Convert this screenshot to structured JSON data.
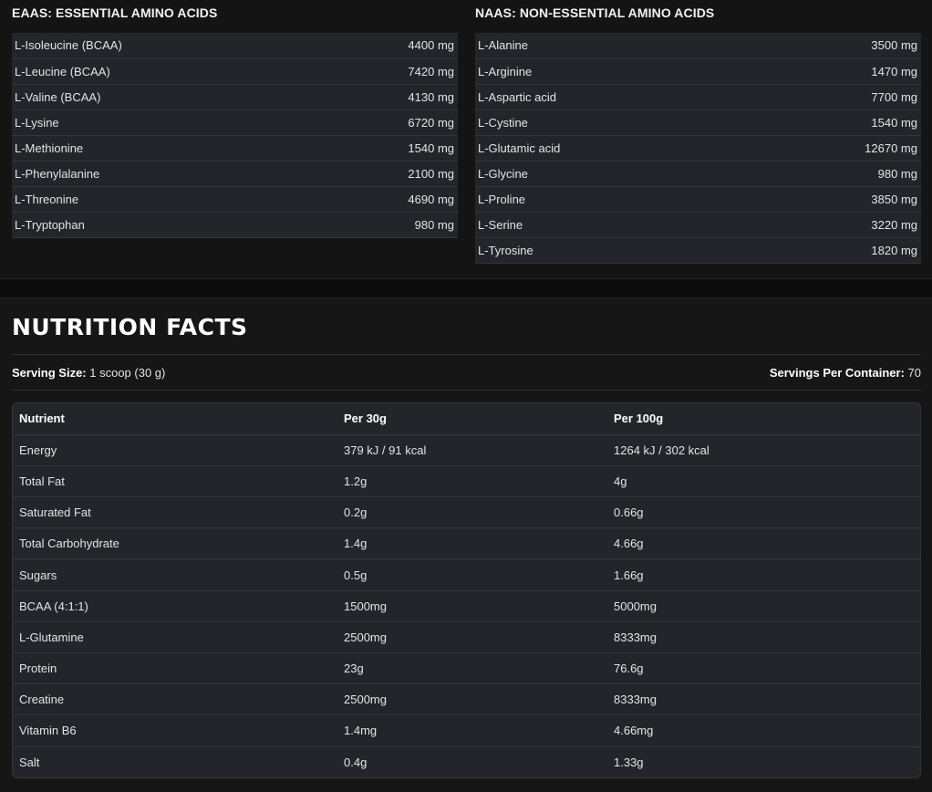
{
  "eaas": {
    "heading": "EAAS: ESSENTIAL AMINO ACIDS",
    "rows": [
      {
        "name": "L-Isoleucine (BCAA)",
        "value": "4400 mg"
      },
      {
        "name": "L-Leucine (BCAA)",
        "value": "7420 mg"
      },
      {
        "name": "L-Valine (BCAA)",
        "value": "4130 mg"
      },
      {
        "name": "L-Lysine",
        "value": "6720 mg"
      },
      {
        "name": "L-Methionine",
        "value": "1540 mg"
      },
      {
        "name": "L-Phenylalanine",
        "value": "2100 mg"
      },
      {
        "name": "L-Threonine",
        "value": "4690 mg"
      },
      {
        "name": "L-Tryptophan",
        "value": "980 mg"
      }
    ]
  },
  "naas": {
    "heading": "NAAS: NON-ESSENTIAL AMINO ACIDS",
    "rows": [
      {
        "name": "L-Alanine",
        "value": "3500 mg"
      },
      {
        "name": "L-Arginine",
        "value": "1470 mg"
      },
      {
        "name": "L-Aspartic acid",
        "value": "7700 mg"
      },
      {
        "name": "L-Cystine",
        "value": "1540 mg"
      },
      {
        "name": "L-Glutamic acid",
        "value": "12670 mg"
      },
      {
        "name": "L-Glycine",
        "value": "980 mg"
      },
      {
        "name": "L-Proline",
        "value": "3850 mg"
      },
      {
        "name": "L-Serine",
        "value": "3220 mg"
      },
      {
        "name": "L-Tyrosine",
        "value": "1820 mg"
      }
    ]
  },
  "nutrition": {
    "title": "NUTRITION FACTS",
    "serving_size_label": "Serving Size:",
    "serving_size_value": " 1 scoop (30 g)",
    "servings_per_container_label": "Servings Per Container:",
    "servings_per_container_value": " 70",
    "columns": [
      "Nutrient",
      "Per 30g",
      "Per 100g"
    ],
    "rows": [
      [
        "Energy",
        "379 kJ / 91 kcal",
        "1264 kJ / 302 kcal"
      ],
      [
        "Total Fat",
        "1.2g",
        "4g"
      ],
      [
        "Saturated Fat",
        "0.2g",
        "0.66g"
      ],
      [
        "Total Carbohydrate",
        "1.4g",
        "4.66g"
      ],
      [
        "Sugars",
        "0.5g",
        "1.66g"
      ],
      [
        "BCAA (4:1:1)",
        "1500mg",
        "5000mg"
      ],
      [
        "L-Glutamine",
        "2500mg",
        "8333mg"
      ],
      [
        "Protein",
        "23g",
        "76.6g"
      ],
      [
        "Creatine",
        "2500mg",
        "8333mg"
      ],
      [
        "Vitamin B6",
        "1.4mg",
        "4.66mg"
      ],
      [
        "Salt",
        "0.4g",
        "1.33g"
      ]
    ]
  },
  "colors": {
    "background": "#141414",
    "table_row": "#23252a",
    "row_border": "#34363b",
    "text": "#e4e4e4",
    "heading": "#ffffff"
  }
}
